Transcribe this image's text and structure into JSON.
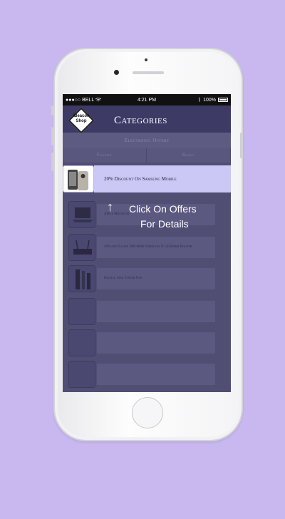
{
  "status_bar": {
    "carrier": "●●●○○ BELL",
    "time": "4:21 PM",
    "battery": "100%"
  },
  "nav": {
    "title": "Categories",
    "logo_line1": "iBeacon",
    "logo_line2": "Shop"
  },
  "subheader": "Electronic Offers",
  "tabs": [
    {
      "label": "Filters"
    },
    {
      "label": "Short"
    }
  ],
  "offers": [
    {
      "text": "20% Discount On Samsung Mobile",
      "icon": "phone-image"
    },
    {
      "text": "Apple Macbook",
      "icon": "laptop-image"
    },
    {
      "text": "30% off D-Link DIR 600N Wireless N 150 Home Router",
      "icon": "router-image"
    },
    {
      "text": "Digital Sina Tower Fan",
      "icon": "tower-fan-image"
    },
    {
      "text": "",
      "icon": ""
    },
    {
      "text": "",
      "icon": ""
    },
    {
      "text": "",
      "icon": ""
    }
  ],
  "hint": {
    "arrow": "↑",
    "line1": "Click On Offers",
    "line2": "For Details"
  },
  "colors": {
    "background": "#c8b8ef",
    "nav": "#3e3a66",
    "active_row": "#ccc8f6"
  }
}
